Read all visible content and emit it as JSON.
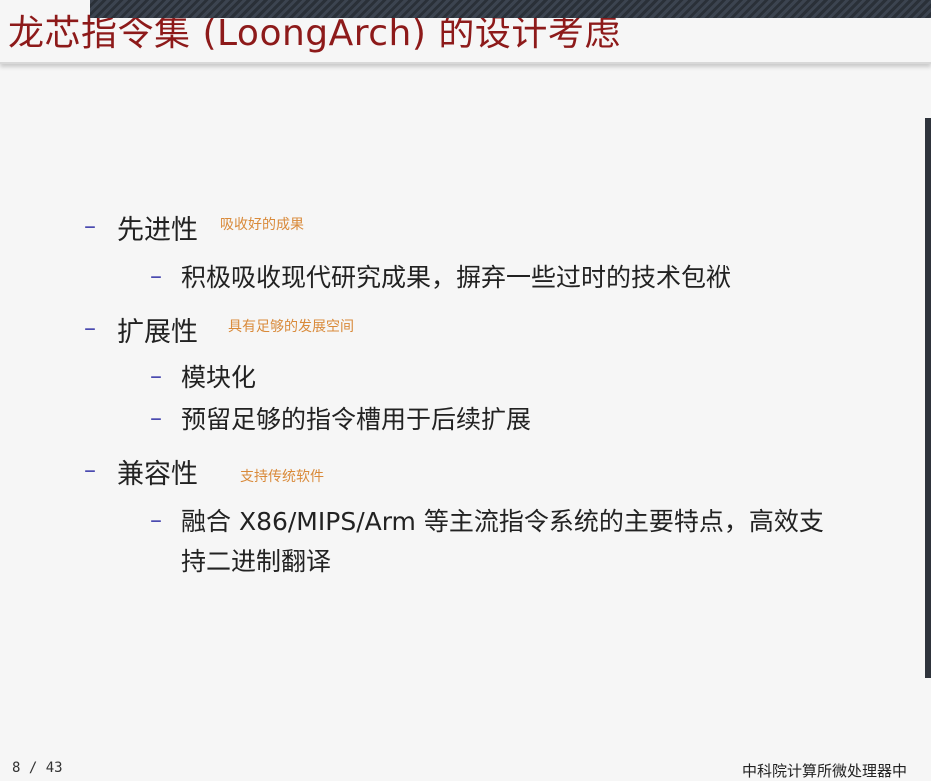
{
  "title": "龙芯指令集 (LoongArch) 的设计考虑",
  "bullets": [
    {
      "label": "先进性",
      "note": "吸收好的成果",
      "sub": [
        "积极吸收现代研究成果，摒弃一些过时的技术包袱"
      ]
    },
    {
      "label": "扩展性",
      "note": "具有足够的发展空间",
      "sub": [
        "模块化",
        "预留足够的指令槽用于后续扩展"
      ]
    },
    {
      "label": "兼容性",
      "note": "支持传统软件",
      "sub": [
        "融合 X86/MIPS/Arm 等主流指令系统的主要特点，高效支",
        "持二进制翻译"
      ]
    }
  ],
  "dash": "–",
  "footer": {
    "page": "8 / 43",
    "institution": "中科院计算所微处理器中"
  },
  "colors": {
    "title": "#8d1a1a",
    "dash": "#4a4ab0",
    "note": "#d98a3a"
  }
}
